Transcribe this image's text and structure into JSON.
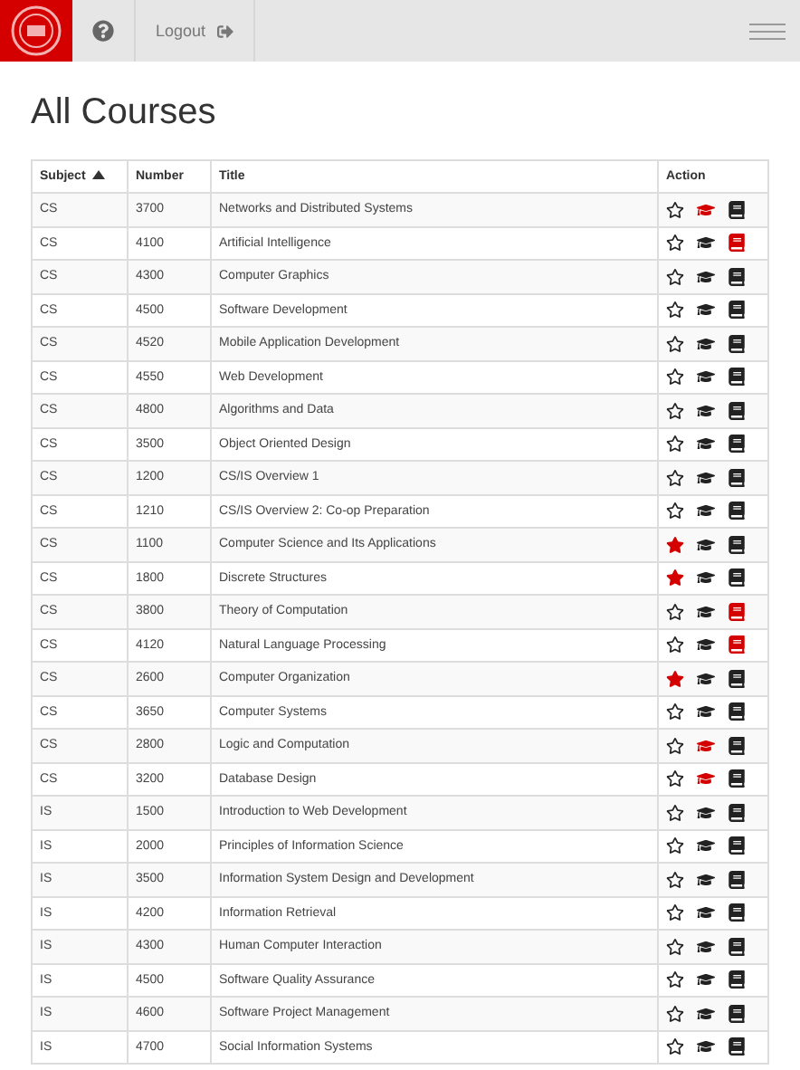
{
  "header": {
    "logout": "Logout"
  },
  "heading": "All Courses",
  "table": {
    "columns": [
      {
        "label": "Subject",
        "sorted": true
      },
      {
        "label": "Number",
        "sorted": false
      },
      {
        "label": "Title",
        "sorted": false
      },
      {
        "label": "Action",
        "sorted": false
      }
    ],
    "rows": [
      {
        "subject": "CS",
        "number": "3700",
        "title": "Networks and Distributed Systems",
        "starred": false,
        "graduated": true,
        "booked": false
      },
      {
        "subject": "CS",
        "number": "4100",
        "title": "Artificial Intelligence",
        "starred": false,
        "graduated": false,
        "booked": true
      },
      {
        "subject": "CS",
        "number": "4300",
        "title": "Computer Graphics",
        "starred": false,
        "graduated": false,
        "booked": false
      },
      {
        "subject": "CS",
        "number": "4500",
        "title": "Software Development",
        "starred": false,
        "graduated": false,
        "booked": false
      },
      {
        "subject": "CS",
        "number": "4520",
        "title": "Mobile Application Development",
        "starred": false,
        "graduated": false,
        "booked": false
      },
      {
        "subject": "CS",
        "number": "4550",
        "title": "Web Development",
        "starred": false,
        "graduated": false,
        "booked": false
      },
      {
        "subject": "CS",
        "number": "4800",
        "title": "Algorithms and Data",
        "starred": false,
        "graduated": false,
        "booked": false
      },
      {
        "subject": "CS",
        "number": "3500",
        "title": "Object Oriented Design",
        "starred": false,
        "graduated": false,
        "booked": false
      },
      {
        "subject": "CS",
        "number": "1200",
        "title": "CS/IS Overview 1",
        "starred": false,
        "graduated": false,
        "booked": false
      },
      {
        "subject": "CS",
        "number": "1210",
        "title": "CS/IS Overview 2: Co-op Preparation",
        "starred": false,
        "graduated": false,
        "booked": false
      },
      {
        "subject": "CS",
        "number": "1100",
        "title": "Computer Science and Its Applications",
        "starred": true,
        "graduated": false,
        "booked": false
      },
      {
        "subject": "CS",
        "number": "1800",
        "title": "Discrete Structures",
        "starred": true,
        "graduated": false,
        "booked": false
      },
      {
        "subject": "CS",
        "number": "3800",
        "title": "Theory of Computation",
        "starred": false,
        "graduated": false,
        "booked": true
      },
      {
        "subject": "CS",
        "number": "4120",
        "title": "Natural Language Processing",
        "starred": false,
        "graduated": false,
        "booked": true
      },
      {
        "subject": "CS",
        "number": "2600",
        "title": "Computer Organization",
        "starred": true,
        "graduated": false,
        "booked": false
      },
      {
        "subject": "CS",
        "number": "3650",
        "title": "Computer Systems",
        "starred": false,
        "graduated": false,
        "booked": false
      },
      {
        "subject": "CS",
        "number": "2800",
        "title": "Logic and Computation",
        "starred": false,
        "graduated": true,
        "booked": false
      },
      {
        "subject": "CS",
        "number": "3200",
        "title": "Database Design",
        "starred": false,
        "graduated": true,
        "booked": false
      },
      {
        "subject": "IS",
        "number": "1500",
        "title": "Introduction to Web Development",
        "starred": false,
        "graduated": false,
        "booked": false
      },
      {
        "subject": "IS",
        "number": "2000",
        "title": "Principles of Information Science",
        "starred": false,
        "graduated": false,
        "booked": false
      },
      {
        "subject": "IS",
        "number": "3500",
        "title": "Information System Design and Development",
        "starred": false,
        "graduated": false,
        "booked": false
      },
      {
        "subject": "IS",
        "number": "4200",
        "title": "Information Retrieval",
        "starred": false,
        "graduated": false,
        "booked": false
      },
      {
        "subject": "IS",
        "number": "4300",
        "title": "Human Computer Interaction",
        "starred": false,
        "graduated": false,
        "booked": false
      },
      {
        "subject": "IS",
        "number": "4500",
        "title": "Software Quality Assurance",
        "starred": false,
        "graduated": false,
        "booked": false
      },
      {
        "subject": "IS",
        "number": "4600",
        "title": "Software Project Management",
        "starred": false,
        "graduated": false,
        "booked": false
      },
      {
        "subject": "IS",
        "number": "4700",
        "title": "Social Information Systems",
        "starred": false,
        "graduated": false,
        "booked": false
      }
    ]
  }
}
